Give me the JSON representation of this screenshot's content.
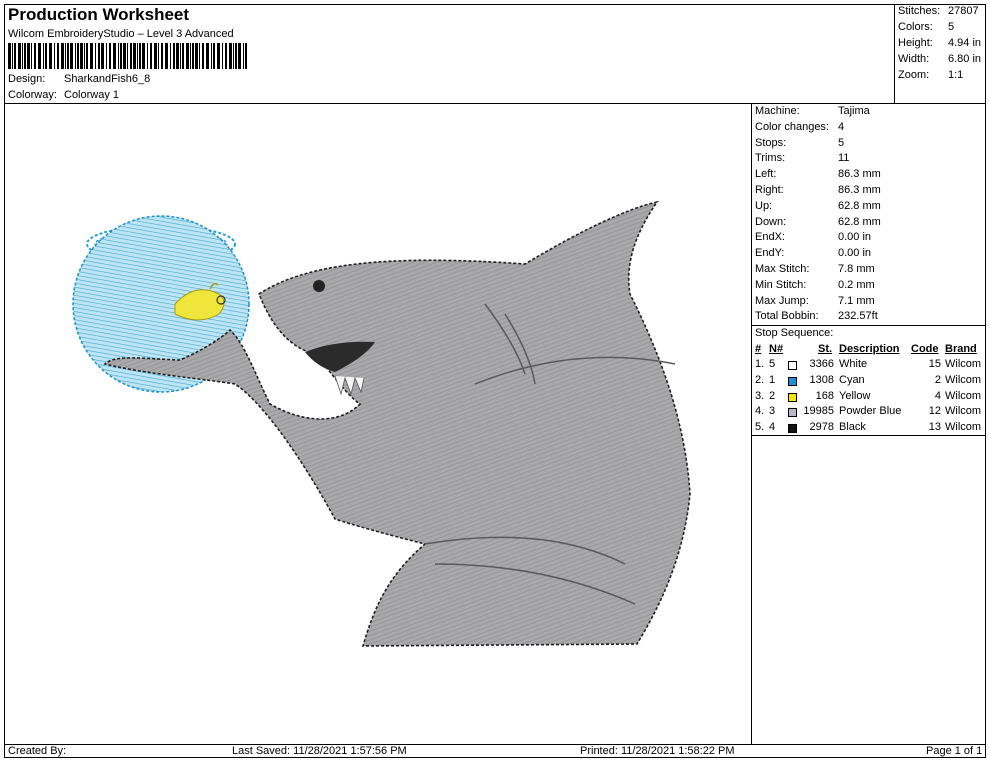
{
  "header": {
    "title": "Production Worksheet",
    "subtitle": "Wilcom EmbroideryStudio – Level 3 Advanced",
    "design_label": "Design:",
    "design_value": "SharkandFish6_8",
    "colorway_label": "Colorway:",
    "colorway_value": "Colorway 1"
  },
  "stats": [
    {
      "label": "Stitches:",
      "value": "27807"
    },
    {
      "label": "Colors:",
      "value": "5"
    },
    {
      "label": "Height:",
      "value": "4.94 in"
    },
    {
      "label": "Width:",
      "value": "6.80 in"
    },
    {
      "label": "Zoom:",
      "value": "1:1"
    }
  ],
  "machine": [
    {
      "label": "Machine:",
      "value": "Tajima"
    },
    {
      "label": "Color changes:",
      "value": "4"
    },
    {
      "label": "Stops:",
      "value": "5"
    },
    {
      "label": "Trims:",
      "value": "11"
    },
    {
      "label": "Left:",
      "value": "86.3 mm"
    },
    {
      "label": "Right:",
      "value": "86.3 mm"
    },
    {
      "label": "Up:",
      "value": "62.8 mm"
    },
    {
      "label": "Down:",
      "value": "62.8 mm"
    },
    {
      "label": "EndX:",
      "value": "0.00 in"
    },
    {
      "label": "EndY:",
      "value": "0.00 in"
    },
    {
      "label": "Max Stitch:",
      "value": "7.8 mm"
    },
    {
      "label": "Min Stitch:",
      "value": "0.2 mm"
    },
    {
      "label": "Max Jump:",
      "value": "7.1 mm"
    },
    {
      "label": "Total Bobbin:",
      "value": "232.57ft"
    }
  ],
  "stop_sequence": {
    "title": "Stop Sequence:",
    "headers": {
      "num": "#",
      "needle": "N#",
      "st": "St.",
      "desc": "Description",
      "code": "Code",
      "brand": "Brand"
    },
    "rows": [
      {
        "num": "1.",
        "needle": "5",
        "color": "#ffffff",
        "st": "3366",
        "desc": "White",
        "code": "15",
        "brand": "Wilcom"
      },
      {
        "num": "2.",
        "needle": "1",
        "color": "#1a8fd6",
        "st": "1308",
        "desc": "Cyan",
        "code": "2",
        "brand": "Wilcom"
      },
      {
        "num": "3.",
        "needle": "2",
        "color": "#f2e600",
        "st": "168",
        "desc": "Yellow",
        "code": "4",
        "brand": "Wilcom"
      },
      {
        "num": "4.",
        "needle": "3",
        "color": "#b9b7c9",
        "st": "19985",
        "desc": "Powder Blue",
        "code": "12",
        "brand": "Wilcom"
      },
      {
        "num": "5.",
        "needle": "4",
        "color": "#111111",
        "st": "2978",
        "desc": "Black",
        "code": "13",
        "brand": "Wilcom"
      }
    ]
  },
  "footer": {
    "created": "Created By:",
    "saved": "Last Saved: 11/28/2021 1:57:56 PM",
    "printed": "Printed: 11/28/2021 1:58:22 PM",
    "page": "Page 1 of 1"
  }
}
